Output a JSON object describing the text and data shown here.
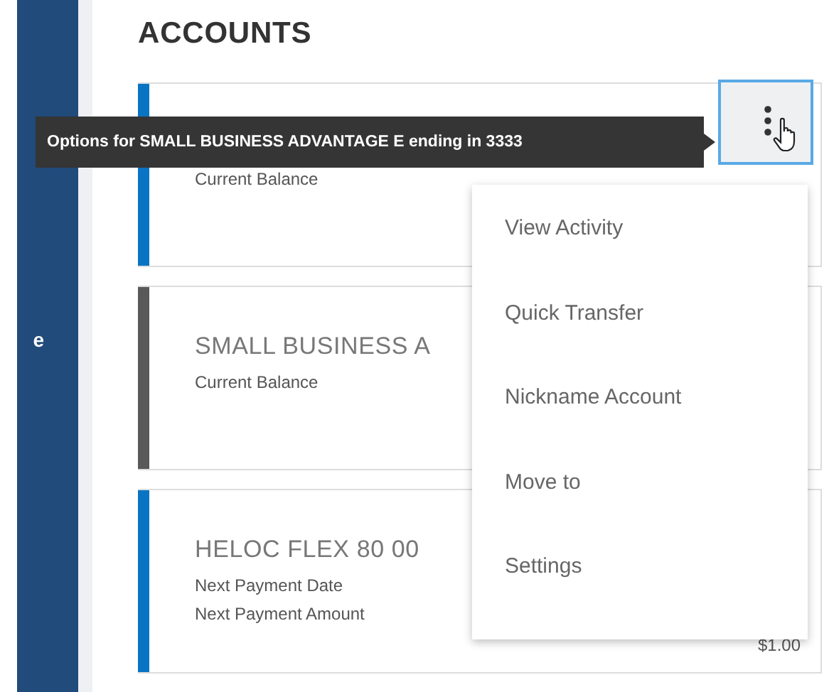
{
  "sidebar": {
    "label": "e"
  },
  "heading": "ACCOUNTS",
  "accounts": [
    {
      "color": "#0a74c4",
      "lines": [
        "Current Balance"
      ],
      "options_focused": true
    },
    {
      "color": "#595959",
      "title": "SMALL BUSINESS A",
      "lines": [
        "Current Balance"
      ],
      "options_focused": false
    },
    {
      "color": "#0a74c4",
      "title": "HELOC FLEX 80 00",
      "lines": [
        "Next Payment Date",
        "Next Payment Amount"
      ],
      "amount": "$1.00",
      "options_focused": false
    }
  ],
  "tooltip": "Options for SMALL BUSINESS ADVANTAGE E ending in 3333",
  "menu": [
    "View Activity",
    "Quick Transfer",
    "Nickname Account",
    "Move to",
    "Settings"
  ]
}
